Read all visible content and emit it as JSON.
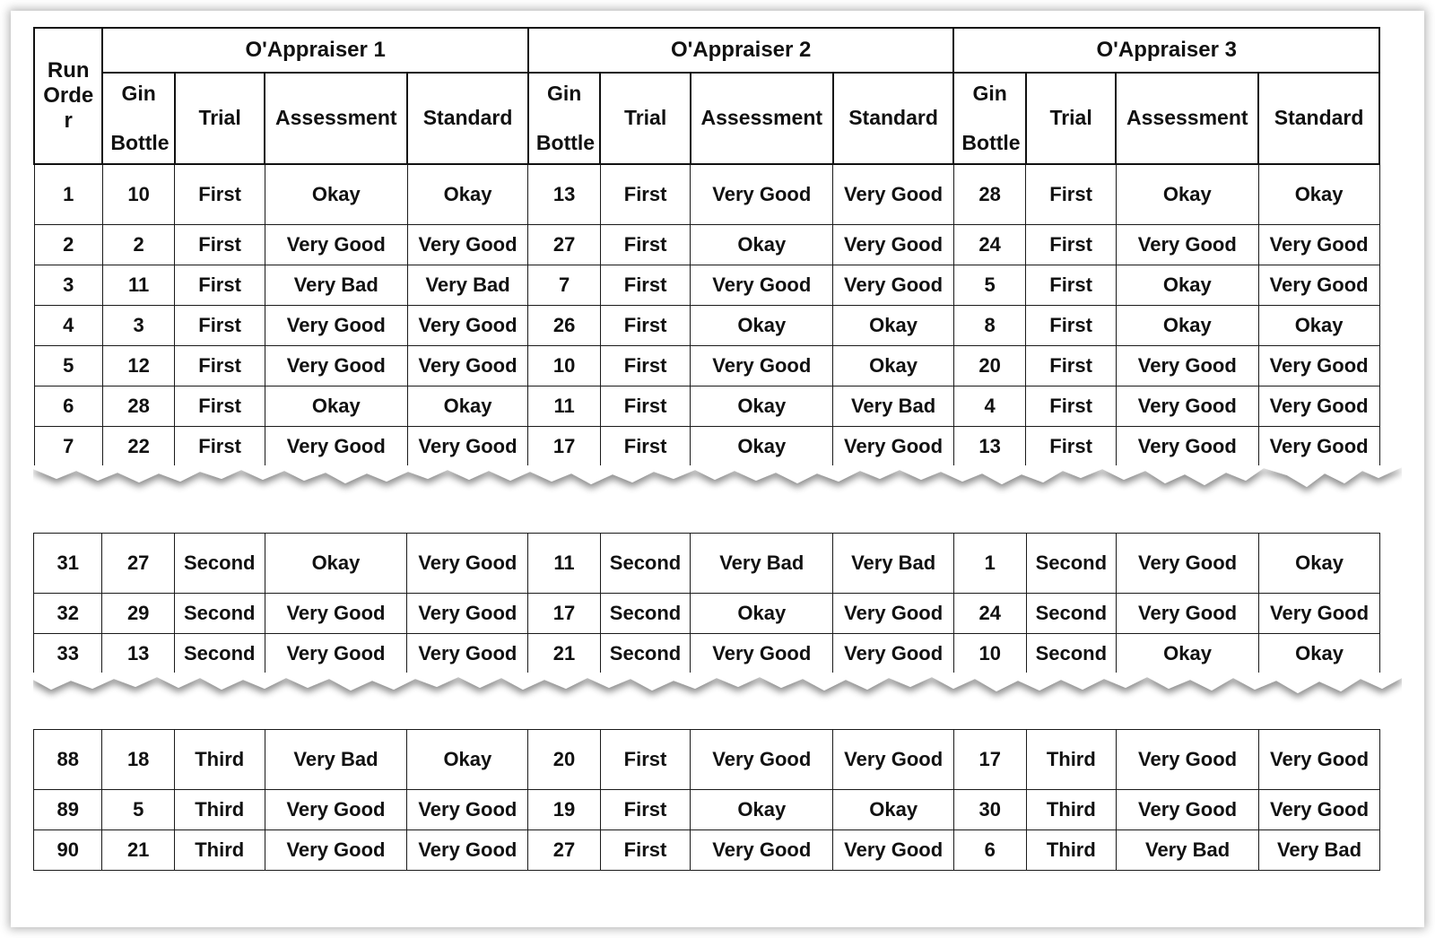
{
  "table": {
    "row_header_label": "Run Order",
    "row_header_lines": [
      "Run",
      "Orde",
      "r"
    ],
    "appraisers": [
      {
        "title": "O'Appraiser 1"
      },
      {
        "title": "O'Appraiser 2"
      },
      {
        "title": "O'Appraiser 3"
      }
    ],
    "sub_headers": {
      "gin_bottle_line1": "Gin",
      "gin_bottle_line2": "Bottle",
      "trial": "Trial",
      "assessment": "Assessment",
      "standard": "Standard"
    },
    "colors": {
      "very_good": "#6BA83E",
      "okay": "#EDB51F",
      "very_bad": "#CC1111",
      "text": "#111111",
      "border": "#1a1a1a",
      "background": "#ffffff"
    },
    "verdict_labels": {
      "very_good": "Very Good",
      "okay": "Okay",
      "very_bad": "Very Bad"
    },
    "blocks": [
      {
        "id": "block-1",
        "rows": [
          {
            "run": "1",
            "a1": {
              "bottle": "10",
              "trial": "First",
              "assessment": "Okay",
              "standard": "Okay"
            },
            "a2": {
              "bottle": "13",
              "trial": "First",
              "assessment": "Very Good",
              "standard": "Very Good"
            },
            "a3": {
              "bottle": "28",
              "trial": "First",
              "assessment": "Okay",
              "standard": "Okay"
            }
          },
          {
            "run": "2",
            "a1": {
              "bottle": "2",
              "trial": "First",
              "assessment": "Very Good",
              "standard": "Very Good"
            },
            "a2": {
              "bottle": "27",
              "trial": "First",
              "assessment": "Okay",
              "standard": "Very Good"
            },
            "a3": {
              "bottle": "24",
              "trial": "First",
              "assessment": "Very Good",
              "standard": "Very Good"
            }
          },
          {
            "run": "3",
            "a1": {
              "bottle": "11",
              "trial": "First",
              "assessment": "Very Bad",
              "standard": "Very Bad"
            },
            "a2": {
              "bottle": "7",
              "trial": "First",
              "assessment": "Very Good",
              "standard": "Very Good"
            },
            "a3": {
              "bottle": "5",
              "trial": "First",
              "assessment": "Okay",
              "standard": "Very Good"
            }
          },
          {
            "run": "4",
            "a1": {
              "bottle": "3",
              "trial": "First",
              "assessment": "Very Good",
              "standard": "Very Good"
            },
            "a2": {
              "bottle": "26",
              "trial": "First",
              "assessment": "Okay",
              "standard": "Okay"
            },
            "a3": {
              "bottle": "8",
              "trial": "First",
              "assessment": "Okay",
              "standard": "Okay"
            }
          },
          {
            "run": "5",
            "a1": {
              "bottle": "12",
              "trial": "First",
              "assessment": "Very Good",
              "standard": "Very Good"
            },
            "a2": {
              "bottle": "10",
              "trial": "First",
              "assessment": "Very Good",
              "standard": "Okay"
            },
            "a3": {
              "bottle": "20",
              "trial": "First",
              "assessment": "Very Good",
              "standard": "Very Good"
            }
          },
          {
            "run": "6",
            "a1": {
              "bottle": "28",
              "trial": "First",
              "assessment": "Okay",
              "standard": "Okay"
            },
            "a2": {
              "bottle": "11",
              "trial": "First",
              "assessment": "Okay",
              "standard": "Very Bad"
            },
            "a3": {
              "bottle": "4",
              "trial": "First",
              "assessment": "Very Good",
              "standard": "Very Good"
            }
          },
          {
            "run": "7",
            "a1": {
              "bottle": "22",
              "trial": "First",
              "assessment": "Very Good",
              "standard": "Very Good"
            },
            "a2": {
              "bottle": "17",
              "trial": "First",
              "assessment": "Okay",
              "standard": "Very Good"
            },
            "a3": {
              "bottle": "13",
              "trial": "First",
              "assessment": "Very Good",
              "standard": "Very Good"
            }
          }
        ]
      },
      {
        "id": "block-2",
        "rows": [
          {
            "run": "31",
            "a1": {
              "bottle": "27",
              "trial": "Second",
              "assessment": "Okay",
              "standard": "Very Good"
            },
            "a2": {
              "bottle": "11",
              "trial": "Second",
              "assessment": "Very Bad",
              "standard": "Very Bad"
            },
            "a3": {
              "bottle": "1",
              "trial": "Second",
              "assessment": "Very Good",
              "standard": "Okay"
            }
          },
          {
            "run": "32",
            "a1": {
              "bottle": "29",
              "trial": "Second",
              "assessment": "Very Good",
              "standard": "Very Good"
            },
            "a2": {
              "bottle": "17",
              "trial": "Second",
              "assessment": "Okay",
              "standard": "Very Good"
            },
            "a3": {
              "bottle": "24",
              "trial": "Second",
              "assessment": "Very Good",
              "standard": "Very Good"
            }
          },
          {
            "run": "33",
            "a1": {
              "bottle": "13",
              "trial": "Second",
              "assessment": "Very Good",
              "standard": "Very Good"
            },
            "a2": {
              "bottle": "21",
              "trial": "Second",
              "assessment": "Very Good",
              "standard": "Very Good"
            },
            "a3": {
              "bottle": "10",
              "trial": "Second",
              "assessment": "Okay",
              "standard": "Okay"
            }
          }
        ]
      },
      {
        "id": "block-3",
        "rows": [
          {
            "run": "88",
            "a1": {
              "bottle": "18",
              "trial": "Third",
              "assessment": "Very Bad",
              "standard": "Okay"
            },
            "a2": {
              "bottle": "20",
              "trial": "First",
              "assessment": "Very Good",
              "standard": "Very Good"
            },
            "a3": {
              "bottle": "17",
              "trial": "Third",
              "assessment": "Very Good",
              "standard": "Very Good"
            }
          },
          {
            "run": "89",
            "a1": {
              "bottle": "5",
              "trial": "Third",
              "assessment": "Very Good",
              "standard": "Very Good"
            },
            "a2": {
              "bottle": "19",
              "trial": "First",
              "assessment": "Okay",
              "standard": "Okay"
            },
            "a3": {
              "bottle": "30",
              "trial": "Third",
              "assessment": "Very Good",
              "standard": "Very Good"
            }
          },
          {
            "run": "90",
            "a1": {
              "bottle": "21",
              "trial": "Third",
              "assessment": "Very Good",
              "standard": "Very Good"
            },
            "a2": {
              "bottle": "27",
              "trial": "First",
              "assessment": "Very Good",
              "standard": "Very Good"
            },
            "a3": {
              "bottle": "6",
              "trial": "Third",
              "assessment": "Very Bad",
              "standard": "Very Bad"
            }
          }
        ]
      }
    ]
  }
}
